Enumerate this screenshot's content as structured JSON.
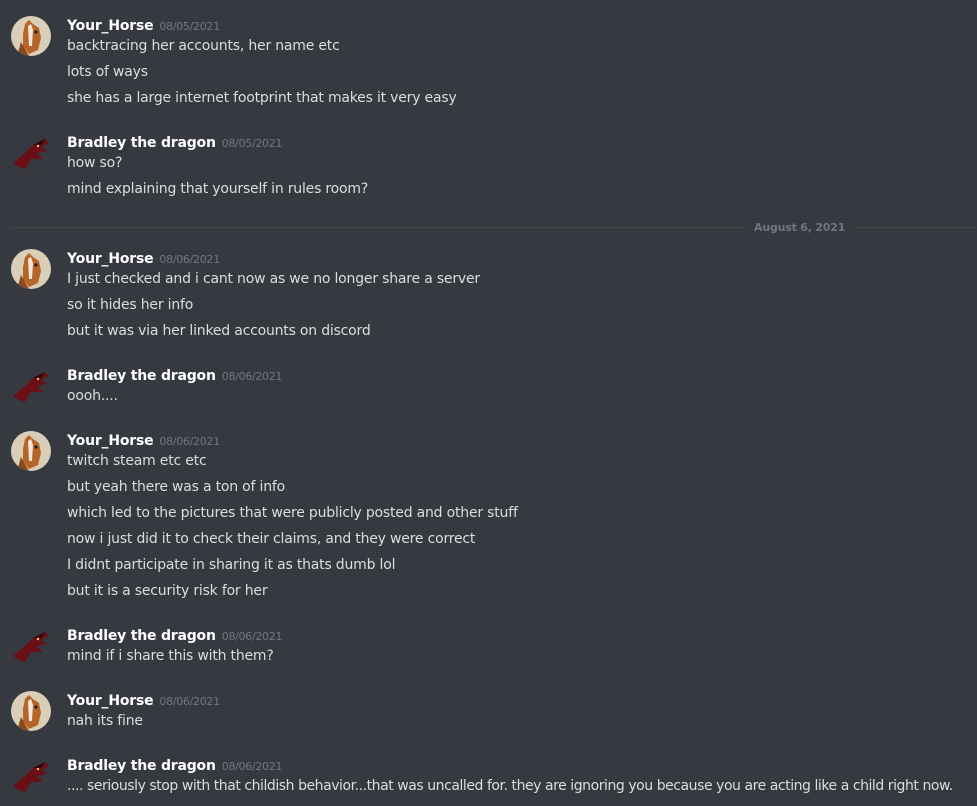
{
  "divider": {
    "label": "August 6, 2021"
  },
  "groups": [
    {
      "author": "Your_Horse",
      "timestamp": "08/05/2021",
      "avatar_icon": "horse-avatar-icon",
      "lines": [
        "backtracing her accounts, her name etc",
        "lots of ways",
        "she has a large internet footprint that makes it very easy"
      ]
    },
    {
      "author": "Bradley the dragon",
      "timestamp": "08/05/2021",
      "avatar_icon": "dragon-avatar-icon",
      "lines": [
        "how so?",
        "mind explaining that yourself in  rules room?"
      ]
    },
    {
      "author": "Your_Horse",
      "timestamp": "08/06/2021",
      "avatar_icon": "horse-avatar-icon",
      "lines": [
        "I just checked and i cant now as we no longer share a server",
        "so it hides her info",
        "but it was via her linked accounts on discord"
      ]
    },
    {
      "author": "Bradley the dragon",
      "timestamp": "08/06/2021",
      "avatar_icon": "dragon-avatar-icon",
      "lines": [
        "oooh...."
      ]
    },
    {
      "author": "Your_Horse",
      "timestamp": "08/06/2021",
      "avatar_icon": "horse-avatar-icon",
      "lines": [
        "twitch steam etc etc",
        "but yeah there was a ton of info",
        "which led to the pictures that were publicly posted and other stuff",
        "now i just did it to check their claims, and they were correct",
        "I didnt participate in sharing it as thats dumb lol",
        "but it is a security risk for her"
      ]
    },
    {
      "author": "Bradley the dragon",
      "timestamp": "08/06/2021",
      "avatar_icon": "dragon-avatar-icon",
      "lines": [
        "mind if i share this with them?"
      ]
    },
    {
      "author": "Your_Horse",
      "timestamp": "08/06/2021",
      "avatar_icon": "horse-avatar-icon",
      "lines": [
        "nah its fine"
      ]
    },
    {
      "author": "Bradley the dragon",
      "timestamp": "08/06/2021",
      "avatar_icon": "dragon-avatar-icon",
      "lines": [
        ".... seriously stop with that childish behavior...that was uncalled for. they are ignoring you because you are acting like a child right now."
      ]
    }
  ]
}
